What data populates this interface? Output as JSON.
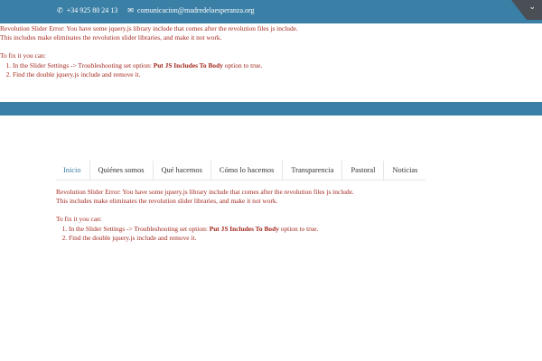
{
  "topbar": {
    "phone": "+34 925 80 24 13",
    "email": "comunicacion@madredelaesperanza.org",
    "icons": {
      "phone": "phone-icon",
      "email": "mail-icon",
      "corner": "chevron-down-icon"
    }
  },
  "errors": [
    {
      "line1": "Revolution Slider Error: You have some jquery.js library include that comes after the revolution files js include.",
      "line2": "This includes make eliminates the revolution slider libraries, and make it not work.",
      "fix_heading": "To fix it you can:",
      "step1_prefix": "In the Slider Settings -> Troubleshooting set option: ",
      "step1_bold": "Put JS Includes To Body",
      "step1_suffix": " option to true.",
      "step2": "Find the double jquery.js include and remove it."
    },
    {
      "line1": "Revolution Slider Error: You have some jquery.js library include that comes after the revolution files js include.",
      "line2": "This includes make eliminates the revolution slider libraries, and make it not work.",
      "fix_heading": "To fix it you can:",
      "step1_prefix": "In the Slider Settings -> Troubleshooting set option: ",
      "step1_bold": "Put JS Includes To Body",
      "step1_suffix": " option to true.",
      "step2": "Find the double jquery.js include and remove it."
    }
  ],
  "nav": {
    "items": [
      {
        "label": "Inicio",
        "active": true
      },
      {
        "label": "Quiénes somos",
        "active": false
      },
      {
        "label": "Qué hacemos",
        "active": false
      },
      {
        "label": "Cómo lo hacemos",
        "active": false
      },
      {
        "label": "Transparencia",
        "active": false
      },
      {
        "label": "Pastoral",
        "active": false
      },
      {
        "label": "Noticias",
        "active": false
      }
    ]
  },
  "colors": {
    "brand_blue": "#3a7fa6",
    "error_red": "#a3281e",
    "corner_tab": "#4a4f56"
  }
}
